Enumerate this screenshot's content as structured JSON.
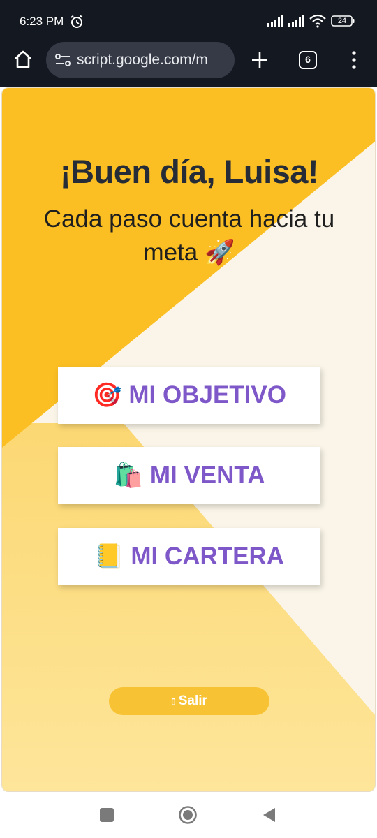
{
  "status_bar": {
    "time": "6:23 PM",
    "battery": "24",
    "icons": [
      "alarm-icon",
      "signal-icon",
      "signal-icon",
      "wifi-icon",
      "battery-icon"
    ]
  },
  "browser": {
    "url": "script.google.com/m",
    "tab_count": "6",
    "icons": [
      "home-icon",
      "site-settings-icon",
      "new-tab-icon",
      "tab-switcher-icon",
      "menu-icon"
    ]
  },
  "page": {
    "greeting": "¡Buen día, Luisa!",
    "subtitle": "Cada paso cuenta hacia tu meta 🚀",
    "buttons": [
      {
        "icon": "🎯",
        "icon_name": "target-icon",
        "label": "MI OBJETIVO"
      },
      {
        "icon": "🛍️",
        "icon_name": "shopping-bags-icon",
        "label": "MI VENTA"
      },
      {
        "icon": "📒",
        "icon_name": "ledger-icon",
        "label": "MI CARTERA"
      }
    ],
    "logout": {
      "glyph": "▯",
      "label": "Salir"
    },
    "colors": {
      "yellow": "#fbbf24",
      "light_yellow": "#fde59a",
      "cream": "#faf5e8",
      "button_text": "#7e57c8",
      "heading": "#252b37"
    }
  },
  "nav_bar": {
    "icons": [
      "recents-icon",
      "home-circle-icon",
      "back-icon"
    ]
  }
}
